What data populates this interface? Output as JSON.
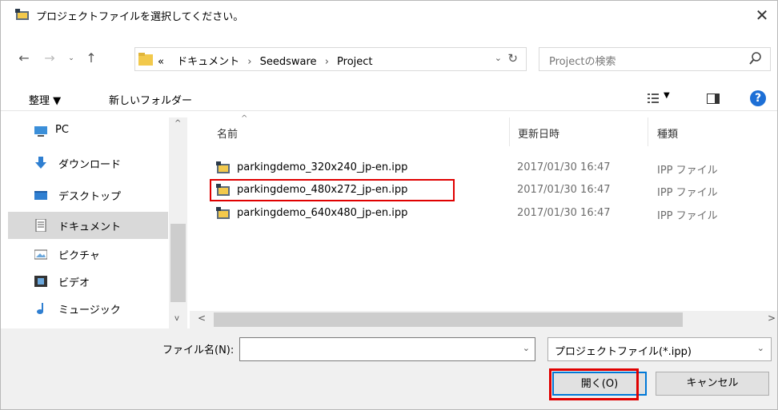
{
  "window": {
    "title": "プロジェクトファイルを選択してください。",
    "close_glyph": "✕"
  },
  "nav": {
    "back_glyph": "←",
    "forward_glyph": "→",
    "recent_glyph": "⌄",
    "up_glyph": "↑",
    "path": {
      "overflow": "«",
      "segments": [
        "ドキュメント",
        "Seedsware",
        "Project"
      ],
      "separator": "›"
    },
    "address_dropdown_glyph": "⌄",
    "refresh_glyph": "↻",
    "search_placeholder": "Projectの検索"
  },
  "toolbar": {
    "organize_label": "整理 ▼",
    "new_folder_label": "新しいフォルダー",
    "view_dropdown_glyph": "▼",
    "help_glyph": "?"
  },
  "sidebar": {
    "items": [
      {
        "label": "PC",
        "icon": "computer-icon"
      },
      {
        "label": "ダウンロード",
        "icon": "download-icon"
      },
      {
        "label": "デスクトップ",
        "icon": "desktop-icon"
      },
      {
        "label": "ドキュメント",
        "icon": "documents-icon",
        "selected": true
      },
      {
        "label": "ピクチャ",
        "icon": "pictures-icon"
      },
      {
        "label": "ビデオ",
        "icon": "videos-icon"
      },
      {
        "label": "ミュージック",
        "icon": "music-icon"
      }
    ],
    "scroll_up_glyph": "^",
    "scroll_down_glyph": "v"
  },
  "file_list": {
    "columns": {
      "name": "名前",
      "modified": "更新日時",
      "type": "種類"
    },
    "sort_glyph": "^",
    "rows": [
      {
        "name": "parkingdemo_320x240_jp-en.ipp",
        "modified": "2017/01/30 16:47",
        "type": "IPP ファイル"
      },
      {
        "name": "parkingdemo_480x272_jp-en.ipp",
        "modified": "2017/01/30 16:47",
        "type": "IPP ファイル",
        "highlighted": true
      },
      {
        "name": "parkingdemo_640x480_jp-en.ipp",
        "modified": "2017/01/30 16:47",
        "type": "IPP ファイル"
      }
    ],
    "hscroll_left_glyph": "<",
    "hscroll_right_glyph": ">"
  },
  "footer": {
    "file_name_label": "ファイル名(N):",
    "file_name_value": "",
    "file_name_dropdown_glyph": "⌄",
    "filter_value": "プロジェクトファイル(*.ipp)",
    "filter_dropdown_glyph": "⌄",
    "open_label": "開く(O)",
    "cancel_label": "キャンセル"
  },
  "colors": {
    "highlight_red": "#e00000",
    "accent_blue": "#0078d7"
  }
}
